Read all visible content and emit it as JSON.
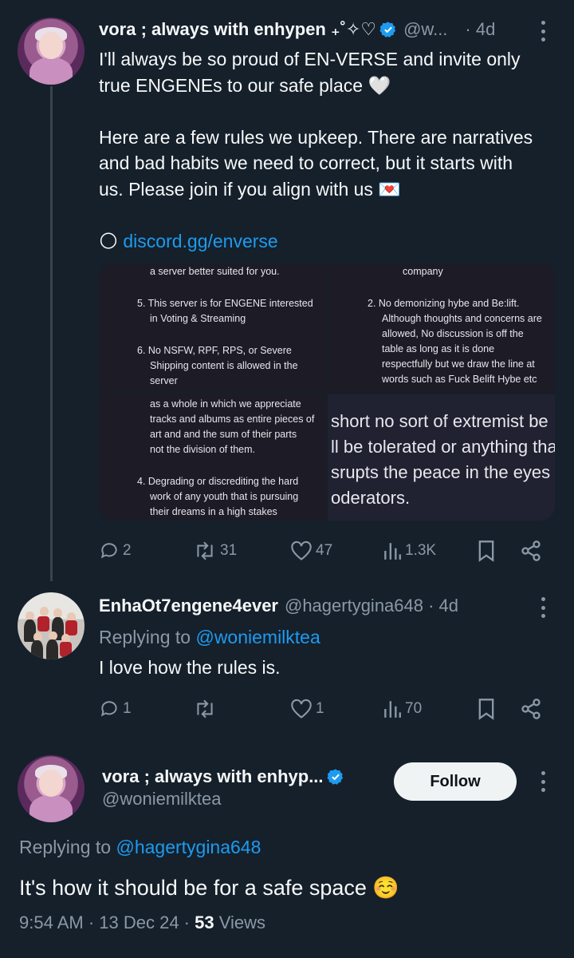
{
  "post1": {
    "name": "vora ; always with enhypen ₊˚✧♡",
    "handle": "@w...",
    "time": "· 4d",
    "line1": "I'll always be so proud of EN-VERSE and invite only",
    "line2": "true ENGENEs to our safe place 🤍",
    "line3": "Here are a few rules we upkeep. There are narratives",
    "line4": "and bad habits we need to correct, but it starts with",
    "line5": "us. Please join if you align with us 💌",
    "link_emoji": "🌕",
    "link": "discord.gg/enverse",
    "replies": "2",
    "reposts": "31",
    "likes": "47",
    "views": "1.3K"
  },
  "media": {
    "tl": {
      "l1": "a server better suited for you.",
      "l2": "5.  This server is for ENGENE interested",
      "l3": "in Voting & Streaming",
      "l4": "6.  No NSFW, RPF, RPS, or Severe",
      "l5": "Shipping content is allowed in the",
      "l6": "server"
    },
    "tr": {
      "l1": "company",
      "l2": "2.  No demonizing hybe and Be:lift.",
      "l3": "Although thoughts and concerns are",
      "l4": "allowed, No discussion is off the",
      "l5": "table as long as it is done",
      "l6": "respectfully but we draw the line at",
      "l7": "words such as Fuck Belift Hybe etc"
    },
    "bl": {
      "l1": "as a whole in which we appreciate",
      "l2": "tracks and albums as entire pieces of",
      "l3": "art and and the sum of their parts",
      "l4": "not the division of them.",
      "l5": "4.  Degrading or discrediting the hard",
      "l6": "work of any youth that is pursuing",
      "l7": "their dreams in a high stakes"
    },
    "br": {
      "l1": "short no sort of extremist be",
      "l2": "ll be tolerated or anything tha",
      "l3": "srupts the peace in the eyes c",
      "l4": "oderators."
    }
  },
  "post2": {
    "name": "EnhaOt7engene4ever",
    "handle": "@hagertygina648 · 4d",
    "replying_prefix": "Replying to ",
    "replying_to": "@woniemilktea",
    "text": "I love how the rules is.",
    "replies": "1",
    "likes": "1",
    "views": "70"
  },
  "post3": {
    "name": "vora ; always with enhyp...",
    "handle": "@woniemilktea",
    "follow_label": "Follow",
    "replying_prefix": "Replying to ",
    "replying_to": "@hagertygina648",
    "text": "It's how it should be for a safe space ☺️",
    "time": "9:54 AM · 13 Dec 24 · ",
    "views_count": "53",
    "views_label": " Views"
  },
  "colors": {
    "background": "#15202b",
    "link": "#1d9bf0",
    "muted": "#8b98a5",
    "verified": "#1d9bf0"
  }
}
